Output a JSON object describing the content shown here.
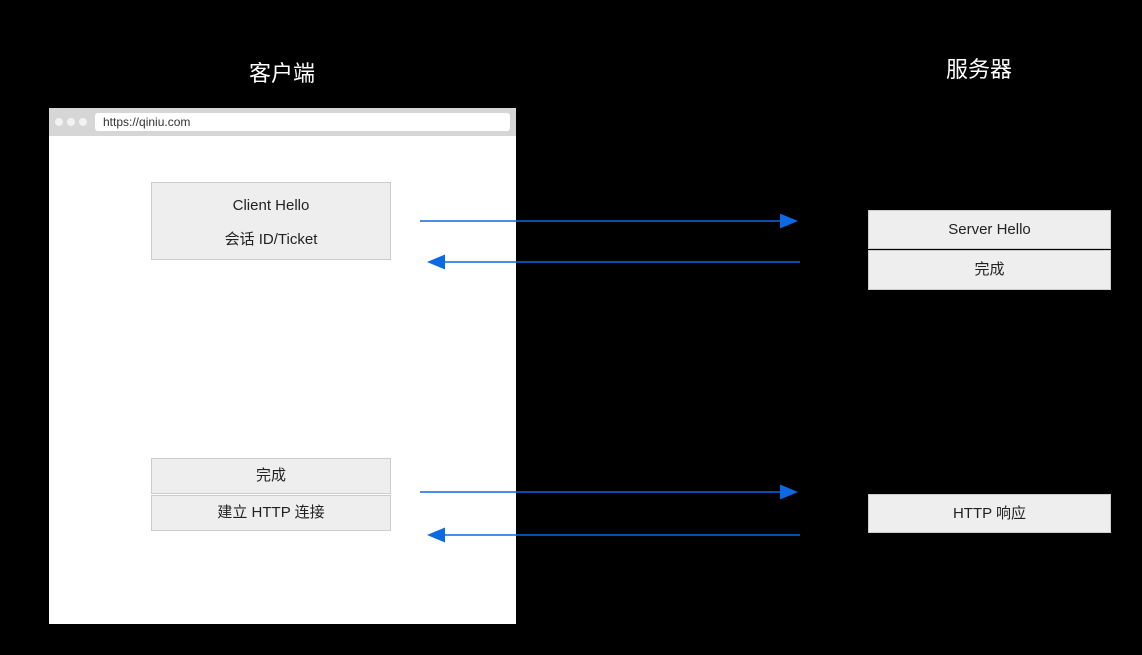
{
  "labels": {
    "client": "客户端",
    "server": "服务器"
  },
  "browser": {
    "url": "https://qiniu.com"
  },
  "client_messages": {
    "hello_line1": "Client Hello",
    "hello_line2": "会话 ID/Ticket",
    "finished": "完成",
    "http_connect": "建立 HTTP 连接"
  },
  "server_messages": {
    "hello": "Server Hello",
    "finished": "完成",
    "http_response": "HTTP 响应"
  },
  "colors": {
    "arrow": "#0b69e3",
    "background": "#000000",
    "box_bg": "#eeeeee"
  }
}
